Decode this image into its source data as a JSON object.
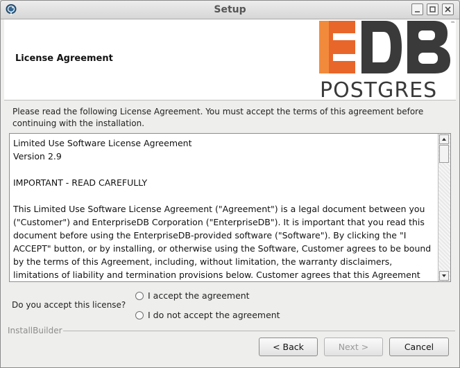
{
  "window": {
    "title": "Setup"
  },
  "header": {
    "title": "License Agreement",
    "logo_top": "EDB",
    "logo_bottom": "POSTGRES",
    "logo_tm": "™"
  },
  "intro": "Please read the following License Agreement. You must accept the terms of this agreement before continuing with the installation.",
  "license": {
    "text": "Limited Use Software License Agreement\nVersion 2.9\n\nIMPORTANT - READ CAREFULLY\n\nThis Limited Use Software License Agreement (\"Agreement\") is a legal document between you (\"Customer\") and EnterpriseDB Corporation (\"EnterpriseDB\"). It is important that you read this document before using the EnterpriseDB-provided software (\"Software\"). By clicking the \"I ACCEPT\" button, or by installing, or otherwise using the Software, Customer agrees to be bound by the terms of this Agreement, including, without limitation, the warranty disclaimers, limitations of liability and termination provisions below. Customer agrees that this Agreement"
  },
  "question": {
    "label": "Do you accept this license?",
    "options": [
      "I accept the agreement",
      "I do not accept the agreement"
    ],
    "selected": null
  },
  "footer": {
    "brand": "InstallBuilder",
    "back_label": "< Back",
    "next_label": "Next >",
    "cancel_label": "Cancel"
  },
  "colors": {
    "logo_orange": "#e8662a",
    "logo_dark": "#3a3a3a",
    "logo_white_bar": "#ffffff"
  }
}
